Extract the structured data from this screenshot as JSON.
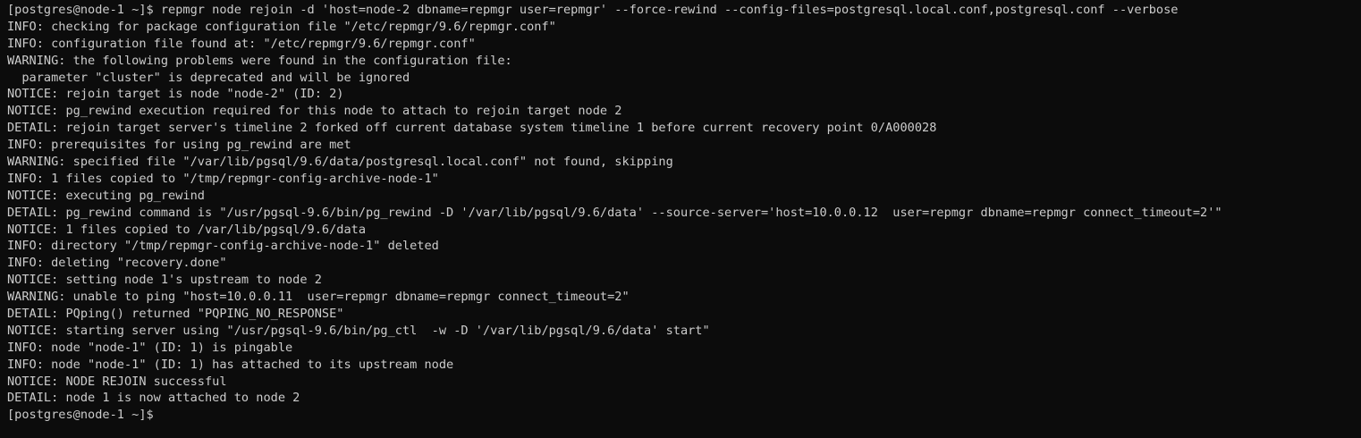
{
  "terminal": {
    "colors": {
      "background": "#0c0c0c",
      "foreground": "#cccccc"
    },
    "lines": [
      "[postgres@node-1 ~]$ repmgr node rejoin -d 'host=node-2 dbname=repmgr user=repmgr' --force-rewind --config-files=postgresql.local.conf,postgresql.conf --verbose",
      "INFO: checking for package configuration file \"/etc/repmgr/9.6/repmgr.conf\"",
      "INFO: configuration file found at: \"/etc/repmgr/9.6/repmgr.conf\"",
      "WARNING: the following problems were found in the configuration file:",
      "  parameter \"cluster\" is deprecated and will be ignored",
      "NOTICE: rejoin target is node \"node-2\" (ID: 2)",
      "NOTICE: pg_rewind execution required for this node to attach to rejoin target node 2",
      "DETAIL: rejoin target server's timeline 2 forked off current database system timeline 1 before current recovery point 0/A000028",
      "INFO: prerequisites for using pg_rewind are met",
      "WARNING: specified file \"/var/lib/pgsql/9.6/data/postgresql.local.conf\" not found, skipping",
      "INFO: 1 files copied to \"/tmp/repmgr-config-archive-node-1\"",
      "NOTICE: executing pg_rewind",
      "DETAIL: pg_rewind command is \"/usr/pgsql-9.6/bin/pg_rewind -D '/var/lib/pgsql/9.6/data' --source-server='host=10.0.0.12  user=repmgr dbname=repmgr connect_timeout=2'\"",
      "NOTICE: 1 files copied to /var/lib/pgsql/9.6/data",
      "INFO: directory \"/tmp/repmgr-config-archive-node-1\" deleted",
      "INFO: deleting \"recovery.done\"",
      "NOTICE: setting node 1's upstream to node 2",
      "WARNING: unable to ping \"host=10.0.0.11  user=repmgr dbname=repmgr connect_timeout=2\"",
      "DETAIL: PQping() returned \"PQPING_NO_RESPONSE\"",
      "NOTICE: starting server using \"/usr/pgsql-9.6/bin/pg_ctl  -w -D '/var/lib/pgsql/9.6/data' start\"",
      "INFO: node \"node-1\" (ID: 1) is pingable",
      "INFO: node \"node-1\" (ID: 1) has attached to its upstream node",
      "NOTICE: NODE REJOIN successful",
      "DETAIL: node 1 is now attached to node 2",
      "[postgres@node-1 ~]$"
    ]
  }
}
